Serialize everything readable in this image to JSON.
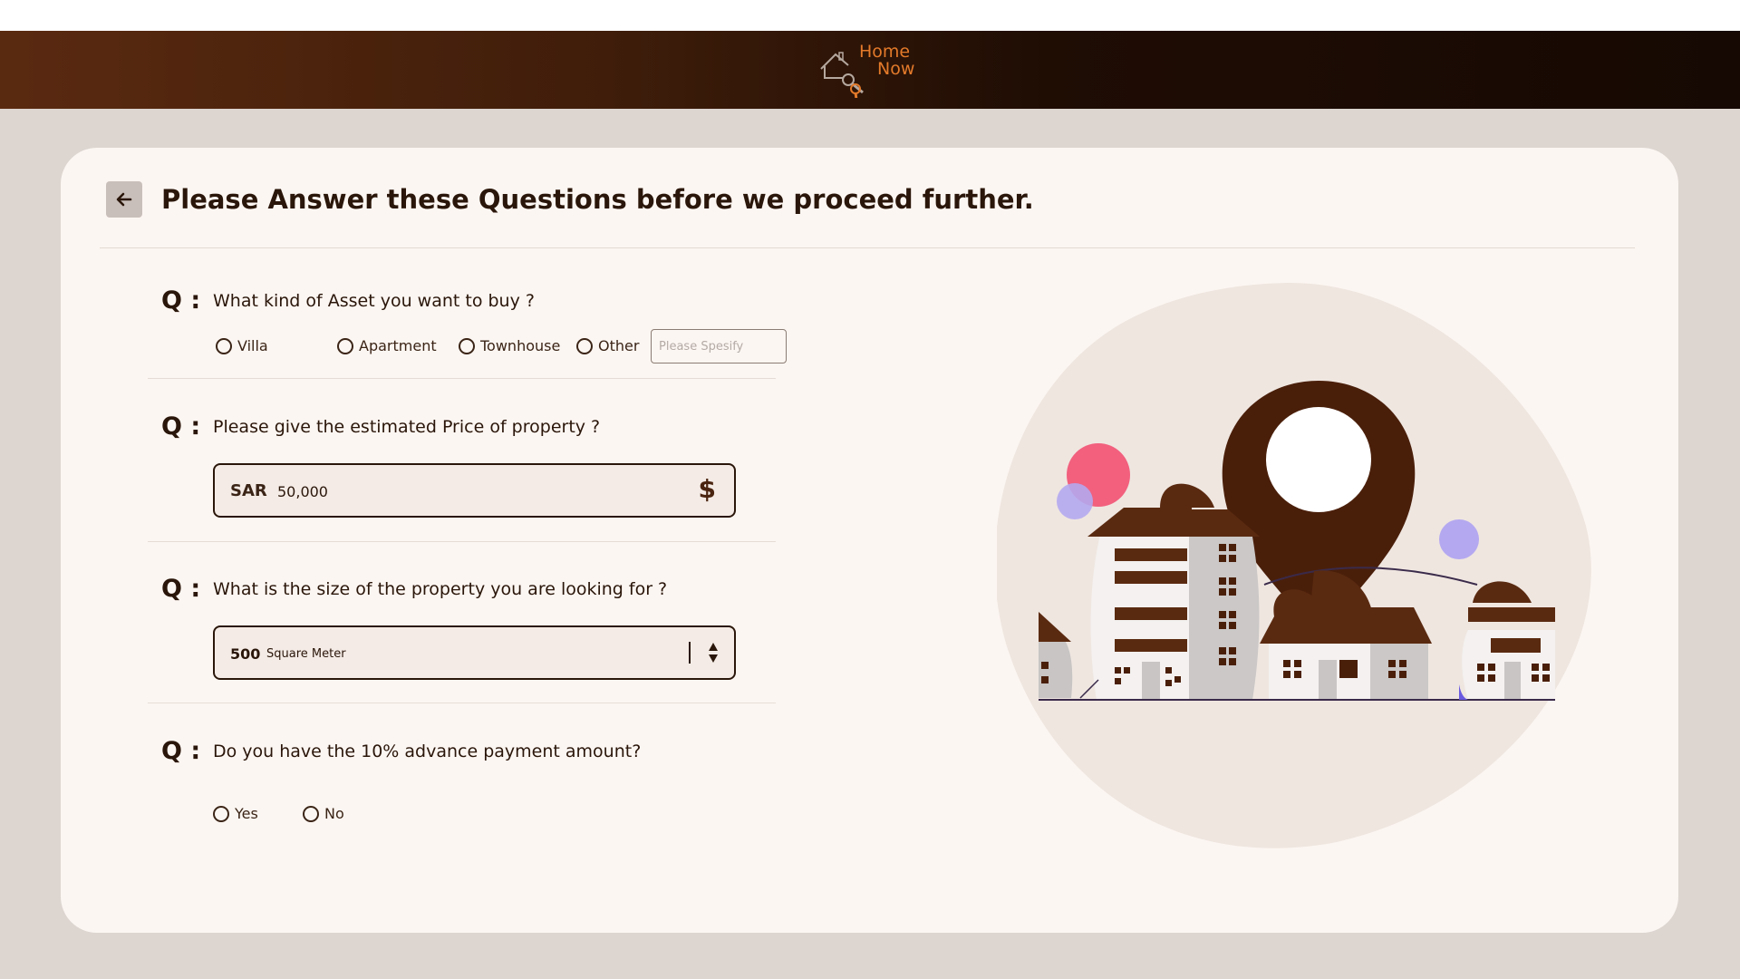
{
  "header": {
    "logo_line1": "Home",
    "logo_line2": "Now"
  },
  "page": {
    "title": "Please Answer these Questions before we proceed further."
  },
  "questions": [
    {
      "label": "Q :",
      "text": "What kind of Asset you want to buy ?",
      "options": [
        "Villa",
        "Apartment",
        "Townhouse",
        "Other"
      ],
      "other_placeholder": "Please Spesify"
    },
    {
      "label": "Q :",
      "text": "Please give the estimated Price of property ?",
      "currency": "SAR",
      "value": "50,000",
      "icon": "dollar-icon"
    },
    {
      "label": "Q :",
      "text": "What is the size of the property you are looking for ?",
      "value": "500",
      "unit": "Square Meter",
      "icon": "sort-arrows-icon"
    },
    {
      "label": "Q :",
      "text": "Do you have the 10% advance payment amount?",
      "options": [
        "Yes",
        "No"
      ]
    }
  ],
  "colors": {
    "brand_dark": "#2a160a",
    "brand_brown": "#5a2a10",
    "logo_orange": "#e37a2a",
    "page_bg": "#dcd5d0",
    "card_bg": "#fcf6f2",
    "accent_pink": "#f2607e",
    "accent_lavender": "#a9a3f0"
  }
}
